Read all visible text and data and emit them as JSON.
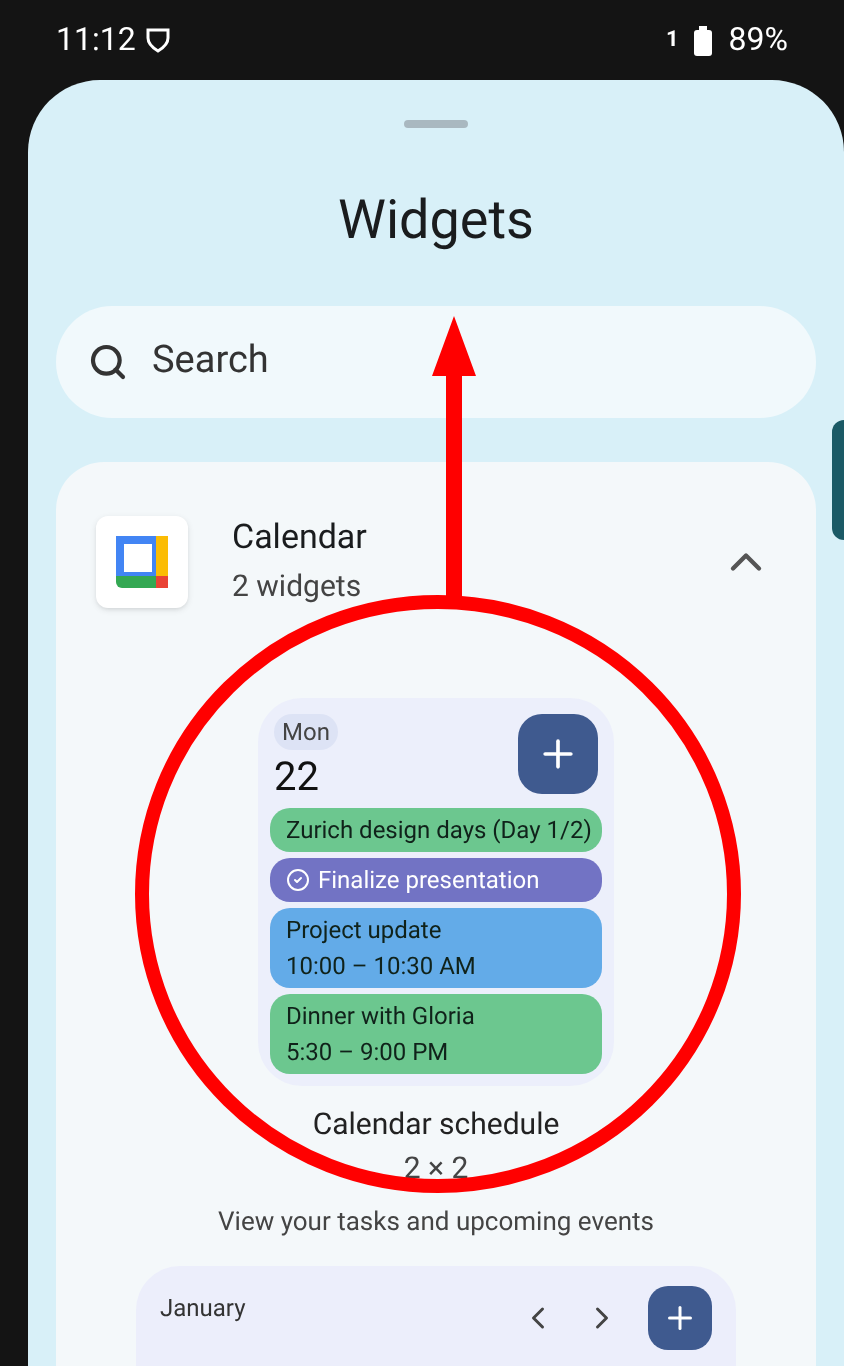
{
  "status_bar": {
    "time": "11:12",
    "sim": "1",
    "battery": "89%"
  },
  "title": "Widgets",
  "search": {
    "placeholder": "Search"
  },
  "app": {
    "name": "Calendar",
    "count": "2 widgets",
    "expanded": true
  },
  "widgets": [
    {
      "kind": "schedule",
      "weekday": "Mon",
      "day": "22",
      "events": [
        {
          "kind": "event",
          "title": "Zurich design days (Day 1/2)",
          "color": "#6cc78f"
        },
        {
          "kind": "task",
          "title": "Finalize presentation",
          "color": "#7273c4"
        },
        {
          "kind": "event",
          "title": "Project update",
          "time": "10:00 – 10:30 AM",
          "color": "#63abe8"
        },
        {
          "kind": "event",
          "title": "Dinner with Gloria",
          "time": "5:30 – 9:00 PM",
          "color": "#6cc78f"
        }
      ],
      "name": "Calendar schedule",
      "size": "2 × 2",
      "description": "View your tasks and upcoming events"
    },
    {
      "kind": "month",
      "month": "January"
    }
  ]
}
